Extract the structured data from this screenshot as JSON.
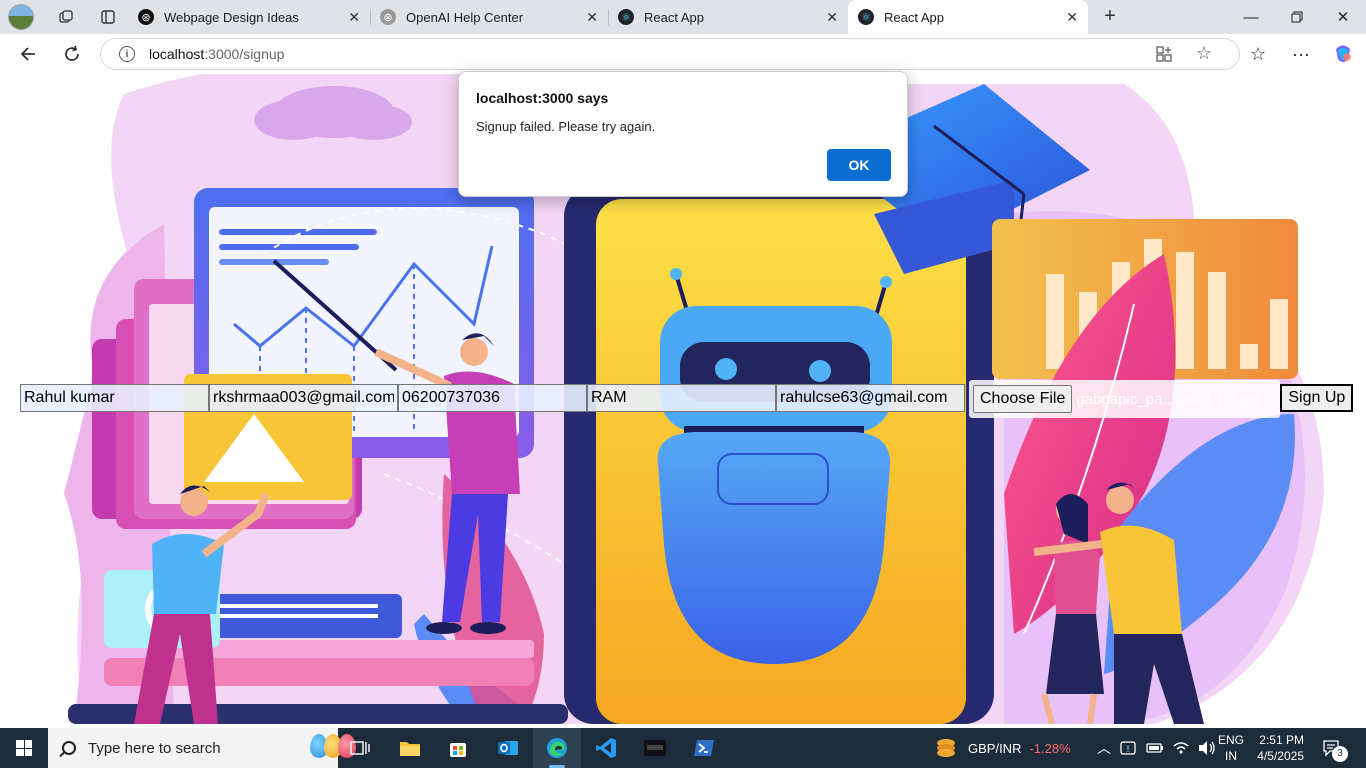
{
  "browser": {
    "tabs": [
      {
        "title": "Webpage Design Ideas",
        "icon": "openai-icon"
      },
      {
        "title": "OpenAI Help Center",
        "icon": "openai-icon"
      },
      {
        "title": "React App",
        "icon": "react-icon"
      },
      {
        "title": "React App",
        "icon": "react-icon",
        "active": true
      }
    ],
    "url_host": "localhost",
    "url_path": ":3000/signup"
  },
  "form": {
    "name_value": "Rahul kumar",
    "email_value": "rkshrmaa003@gmail.com",
    "phone_value": "06200737036",
    "field4_value": "RAM",
    "field5_value": "rahulcse63@gmail.com",
    "file_button_label": "Choose File",
    "file_name": "gabgapic_pa...-9001 (1).jpg",
    "submit_label": "Sign Up"
  },
  "dialog": {
    "title": "localhost:3000 says",
    "message": "Signup failed. Please try again.",
    "ok_label": "OK"
  },
  "taskbar": {
    "search_placeholder": "Type here to search",
    "ticker_label": "GBP/INR",
    "ticker_change": "-1.28%",
    "lang_line1": "ENG",
    "lang_line2": "IN",
    "time": "2:51 PM",
    "date": "4/5/2025",
    "notification_count": "3"
  },
  "colors": {
    "accent": "#0a6ed1",
    "ticker_negative": "#ff6b6b",
    "taskbar_bg": "#1c2c3a"
  }
}
